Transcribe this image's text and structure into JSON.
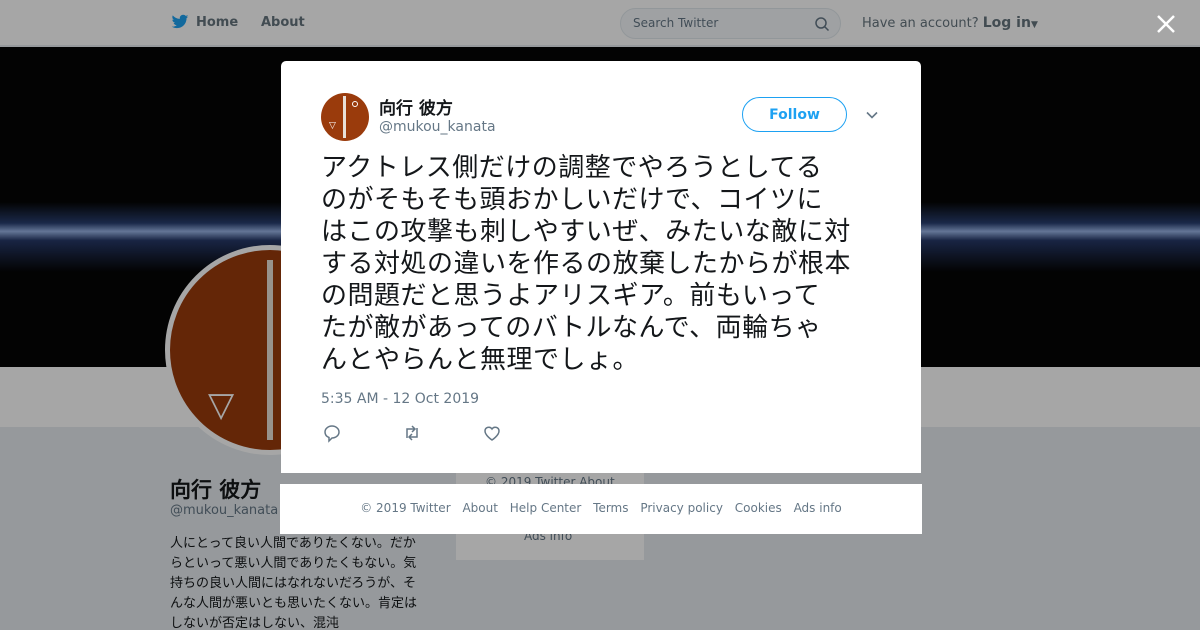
{
  "topnav": {
    "home_label": "Home",
    "about_label": "About",
    "search_placeholder": "Search Twitter",
    "account_prompt": "Have an account?",
    "login_label": "Log in"
  },
  "profile_bg": {
    "name": "向行 彼方",
    "handle": "@mukou_kanata",
    "bio": "人にとって良い人間でありたくない。だからといって悪い人間でありたくもない。気持ちの良い人間にはなれないだろうが、そんな人間が悪いとも思いたくない。肯定はしないが否定はしない、混沌",
    "side_text": "© 2019 Twitter   About",
    "side_ads": "Ads info"
  },
  "tweet": {
    "author_name": "向行 彼方",
    "author_handle": "@mukou_kanata",
    "follow_label": "Follow",
    "text_lines": [
      "アクトレス側だけの調整でやろうとしてる",
      "のがそもそも頭おかしいだけで、コイツに",
      "はこの攻撃も刺しやすいぜ、みたいな敵に対",
      "する対処の違いを作るの放棄したからが根本",
      "の問題だと思うよアリスギア。前もいって",
      "たが敵があってのバトルなんで、両輪ちゃ",
      "んとやらんと無理でしょ。"
    ],
    "timestamp": "5:35 AM - 12 Oct 2019"
  },
  "footer": {
    "links": [
      "© 2019 Twitter",
      "About",
      "Help Center",
      "Terms",
      "Privacy policy",
      "Cookies",
      "Ads info"
    ]
  },
  "colors": {
    "accent": "#1da1f2",
    "muted": "#657786",
    "avatar_bg": "#9a3b0c"
  }
}
